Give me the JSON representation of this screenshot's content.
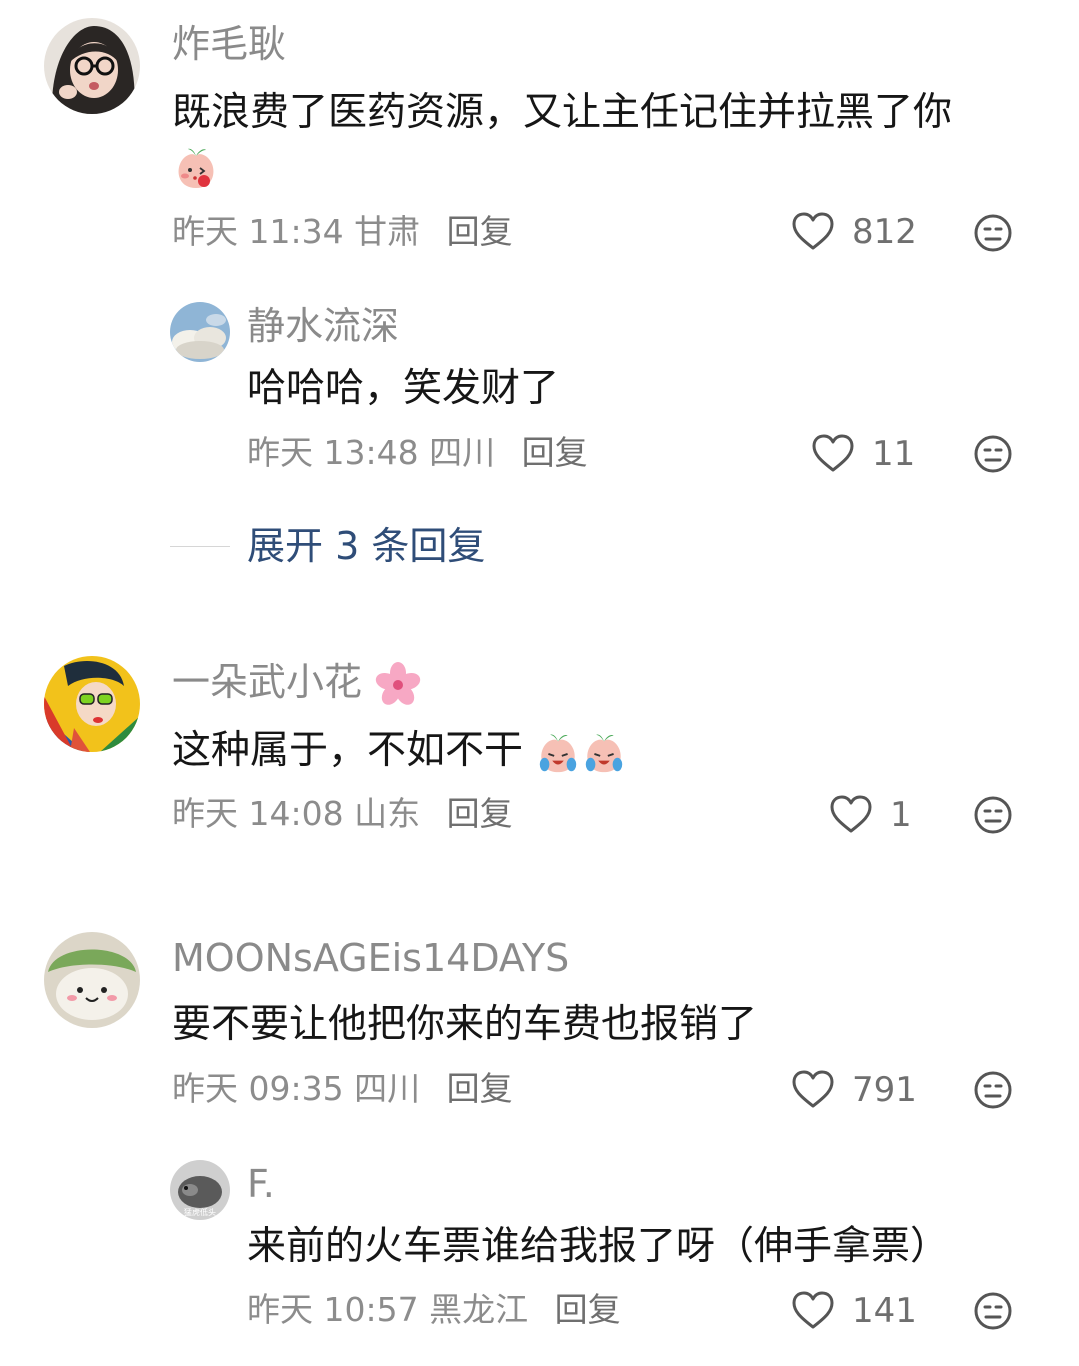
{
  "comments": [
    {
      "username": "炸毛耿",
      "text": "既浪费了医药资源，又让主任记住并拉黑了你",
      "emoji": "blushing-peach-emoji",
      "time": "昨天 11:34",
      "location": "甘肃",
      "reply_label": "回复",
      "likes": "812",
      "replies": [
        {
          "username": "静水流深",
          "text": "哈哈哈，笑发财了",
          "time": "昨天 13:48",
          "location": "四川",
          "reply_label": "回复",
          "likes": "11"
        }
      ],
      "expand_label": "展开 3 条回复"
    },
    {
      "username": "一朵武小花",
      "username_emoji": "cherry-blossom-emoji",
      "text": "这种属于，不如不干",
      "emoji": "crying-peach-emoji",
      "time": "昨天 14:08",
      "location": "山东",
      "reply_label": "回复",
      "likes": "1"
    },
    {
      "username": "MOONsAGEis14DAYS",
      "text": "要不要让他把你来的车费也报销了",
      "time": "昨天 09:35",
      "location": "四川",
      "reply_label": "回复",
      "likes": "791",
      "replies": [
        {
          "username": "F.",
          "avatar_caption": "猛虎低头",
          "text": "来前的火车票谁给我报了呀（伸手拿票）",
          "time": "昨天 10:57",
          "location": "黑龙江",
          "reply_label": "回复",
          "likes": "141"
        }
      ]
    }
  ],
  "icons": {
    "like": "heart-outline-icon",
    "dislike": "meh-face-icon"
  },
  "colors": {
    "username": "#8a8a8a",
    "text": "#161616",
    "meta": "#8c8c8c",
    "expand": "#2f4d78",
    "background": "#ffffff"
  }
}
